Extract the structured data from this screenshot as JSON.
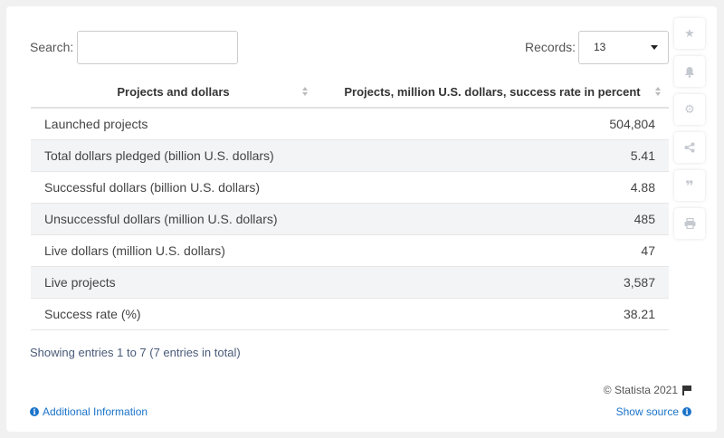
{
  "controls": {
    "search_label": "Search:",
    "search_value": "",
    "records_label": "Records:",
    "records_value": "13"
  },
  "table": {
    "headers": [
      "Projects and dollars",
      "Projects, million U.S. dollars, success rate in percent"
    ],
    "rows": [
      {
        "label": "Launched projects",
        "value": "504,804"
      },
      {
        "label": "Total dollars pledged (billion U.S. dollars)",
        "value": "5.41"
      },
      {
        "label": "Successful dollars (billion U.S. dollars)",
        "value": "4.88"
      },
      {
        "label": "Unsuccessful dollars (million U.S. dollars)",
        "value": "485"
      },
      {
        "label": "Live dollars (million U.S. dollars)",
        "value": "47"
      },
      {
        "label": "Live projects",
        "value": "3,587"
      },
      {
        "label": "Success rate (%)",
        "value": "38.21"
      }
    ]
  },
  "footer": {
    "showing": "Showing entries 1 to 7 (7 entries in total)",
    "copyright": "© Statista 2021",
    "additional_info": "Additional Information",
    "show_source": "Show source"
  },
  "sidebar": {
    "icons": [
      "star-icon",
      "bell-icon",
      "gear-icon",
      "share-icon",
      "quote-icon",
      "print-icon"
    ]
  },
  "colors": {
    "link": "#1a73c9",
    "stripe": "#f3f4f6",
    "icon_gray": "#c5c9d0"
  }
}
